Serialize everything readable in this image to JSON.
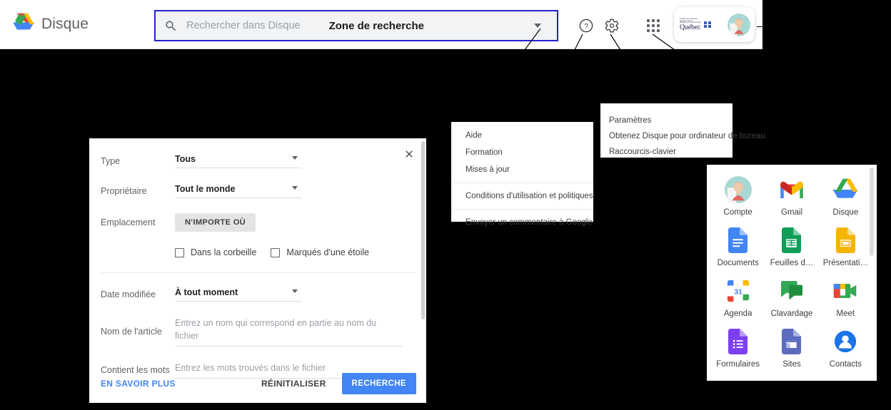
{
  "header": {
    "brand_label": "Disque",
    "brand_icon": "google-drive-logo",
    "search": {
      "placeholder": "Rechercher dans Disque",
      "value": "",
      "annotation_label": "Zone de recherche",
      "search_icon": "search-icon",
      "caret_icon": "chevron-down-icon"
    },
    "icons": {
      "help": "help-circle-icon",
      "settings": "gear-icon",
      "apps": "apps-grid-icon"
    },
    "account_chip": {
      "org_line1": "Centre de services",
      "org_line2": "scolaire de la",
      "org_line3": "Région-de-Sherbrooke",
      "org_wordmark": "Québec",
      "avatar_icon": "user-avatar"
    }
  },
  "filter_panel": {
    "close_icon": "close-icon",
    "rows": {
      "type": {
        "label": "Type",
        "value": "Tous"
      },
      "owner": {
        "label": "Propriétaire",
        "value": "Tout le monde"
      },
      "location": {
        "label": "Emplacement",
        "button": "N'IMPORTE OÙ"
      },
      "date_modified": {
        "label": "Date modifiée",
        "value": "À tout moment"
      },
      "item_name": {
        "label": "Nom de l'article",
        "placeholder": "Entrez un nom qui correspond en partie au nom du fichier",
        "value": ""
      },
      "contains_words": {
        "label": "Contient les mots",
        "placeholder": "Entrez les mots trouvés dans le fichier",
        "value": ""
      }
    },
    "checkboxes": [
      {
        "label": "Dans la corbeille",
        "checked": false
      },
      {
        "label": "Marqués d'une étoile",
        "checked": false
      }
    ],
    "footer": {
      "learn_more": "EN SAVOIR PLUS",
      "reset": "RÉINITIALISER",
      "search": "RECHERCHE"
    }
  },
  "help_menu": {
    "items": [
      "Aide",
      "Formation",
      "Mises à jour",
      "Conditions d'utilisation et politiques",
      "Envoyer un commentaire à Google"
    ]
  },
  "settings_menu": {
    "items": [
      "Paramètres",
      "Obtenez Disque pour ordinateur de bureau",
      "Raccourcis-clavier"
    ]
  },
  "apps_panel": {
    "apps": [
      {
        "label": "Compte",
        "icon": "account-avatar-icon"
      },
      {
        "label": "Gmail",
        "icon": "gmail-icon"
      },
      {
        "label": "Disque",
        "icon": "drive-icon"
      },
      {
        "label": "Documents",
        "icon": "docs-icon"
      },
      {
        "label": "Feuilles d…",
        "icon": "sheets-icon"
      },
      {
        "label": "Présentati…",
        "icon": "slides-icon"
      },
      {
        "label": "Agenda",
        "icon": "calendar-icon"
      },
      {
        "label": "Clavardage",
        "icon": "chat-icon"
      },
      {
        "label": "Meet",
        "icon": "meet-icon"
      },
      {
        "label": "Formulaires",
        "icon": "forms-icon"
      },
      {
        "label": "Sites",
        "icon": "sites-icon"
      },
      {
        "label": "Contacts",
        "icon": "contacts-icon"
      }
    ]
  },
  "colors": {
    "accent_blue": "#4285f4",
    "search_outline": "#2222cc",
    "background": "#000000",
    "panel": "#ffffff"
  }
}
